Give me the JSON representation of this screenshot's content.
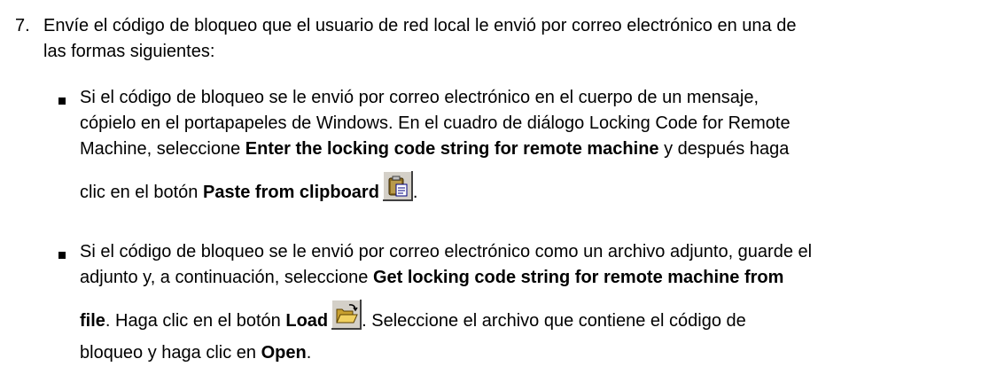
{
  "step": {
    "number": "7.",
    "text_line1": "Envíe el código de bloqueo que el usuario de red local le envió por correo electrónico en una de",
    "text_line2": "las formas siguientes:"
  },
  "bullet1": {
    "line1": "Si el código de bloqueo se le envió por correo electrónico en el cuerpo de un mensaje,",
    "line2": "cópielo en el portapapeles de Windows. En el cuadro de diálogo Locking Code for Remote",
    "line3_pre": "Machine, seleccione ",
    "line3_bold": "Enter the locking code string for remote machine",
    "line3_post": " y después haga",
    "line4_pre": "clic en el botón ",
    "line4_bold": "Paste from clipboard",
    "line4_post": ".",
    "icon": "paste-clipboard-icon"
  },
  "bullet2": {
    "line1": "Si el código de bloqueo se le envió por correo electrónico como un archivo adjunto, guarde el",
    "line2_pre": "adjunto y, a continuación, seleccione ",
    "line2_bold": "Get locking code string for remote machine from",
    "line3_bold": "file",
    "line3_mid": ". Haga clic en el botón ",
    "line3_bold2": "Load",
    "line3_post": ". Seleccione el archivo que contiene el código de",
    "line4_pre": "bloqueo y haga clic en ",
    "line4_bold": "Open",
    "line4_post": ".",
    "icon": "open-folder-icon"
  }
}
